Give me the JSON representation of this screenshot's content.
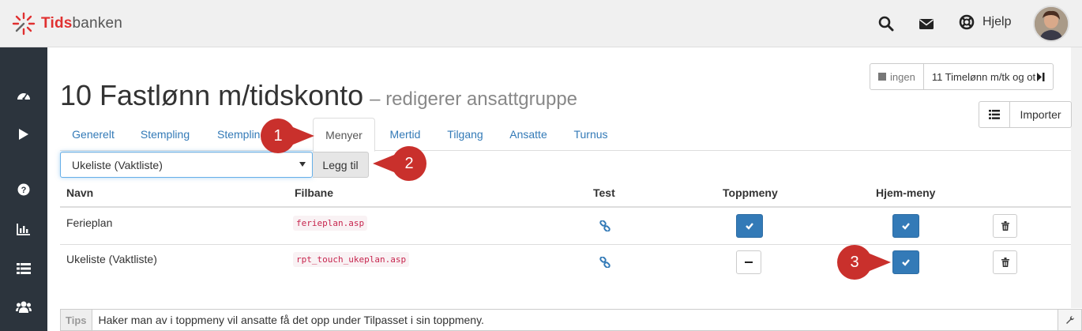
{
  "app": {
    "brand_part1": "Tids",
    "brand_part2": "banken",
    "help_label": "Hjelp"
  },
  "page": {
    "title": "10 Fastlønn m/tidskonto",
    "subtitle": "– redigerer ansattgruppe"
  },
  "nav_buttons": {
    "prev_label": "ingen",
    "next_label": "11 Timelønn m/tk og ot",
    "import_label": "Importer"
  },
  "tabs": [
    {
      "label": "Generelt"
    },
    {
      "label": "Stempling"
    },
    {
      "label": "Stempling"
    },
    {
      "label": "Menyer"
    },
    {
      "label": "Mertid"
    },
    {
      "label": "Tilgang"
    },
    {
      "label": "Ansatte"
    },
    {
      "label": "Turnus"
    }
  ],
  "menu_select": {
    "value": "Ukeliste (Vaktliste)",
    "add_label": "Legg til"
  },
  "table": {
    "headers": {
      "name": "Navn",
      "path": "Filbane",
      "test": "Test",
      "top_menu": "Toppmeny",
      "home_menu": "Hjem-meny"
    },
    "rows": [
      {
        "name": "Ferieplan",
        "path": "ferieplan.asp",
        "top_menu": true,
        "home_menu": true
      },
      {
        "name": "Ukeliste (Vaktliste)",
        "path": "rpt_touch_ukeplan.asp",
        "top_menu": false,
        "home_menu": true
      }
    ]
  },
  "tips": {
    "label": "Tips",
    "text": "Haker man av i toppmeny vil ansatte få det opp under Tilpasset i sin toppmeny."
  },
  "callouts": [
    "1",
    "2",
    "3"
  ],
  "colors": {
    "primary": "#337ab7",
    "callout_red": "#c9302c",
    "sidebar": "#2c343d",
    "brand_red": "#e03030"
  }
}
